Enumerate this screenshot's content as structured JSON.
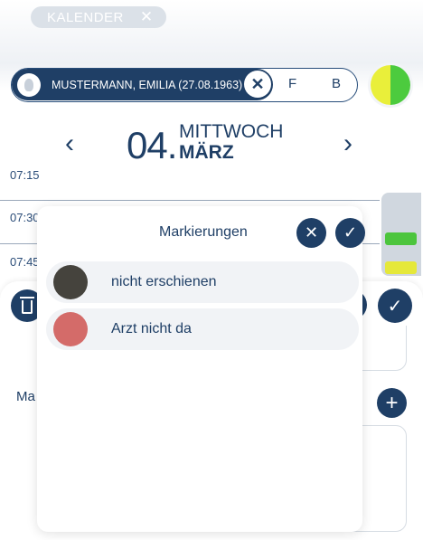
{
  "calendar_tag": {
    "label": "KALENDER",
    "close_icon": "✕"
  },
  "patient": {
    "name": "MUSTERMANN, EMILIA (27.08.1963)",
    "clear_icon": "✕",
    "option_f": "F",
    "option_b": "B"
  },
  "status_colors": {
    "left": "#e9ef3a",
    "right": "#4ccb3e"
  },
  "date": {
    "prev_icon": "‹",
    "day": "04.",
    "weekday": "MITTWOCH",
    "month": "MÄRZ",
    "next_icon": "›"
  },
  "timeline": {
    "times": [
      "07:15",
      "07:30",
      "07:45"
    ]
  },
  "background_form": {
    "label_partial": "Ma",
    "plus_icon": "+",
    "check_icon": "✓"
  },
  "popup": {
    "title": "Markierungen",
    "cancel_icon": "✕",
    "confirm_icon": "✓",
    "items": [
      {
        "label": "nicht erschienen",
        "color": "#45433d"
      },
      {
        "label": "Arzt nicht da",
        "color": "#d46b69"
      }
    ]
  }
}
